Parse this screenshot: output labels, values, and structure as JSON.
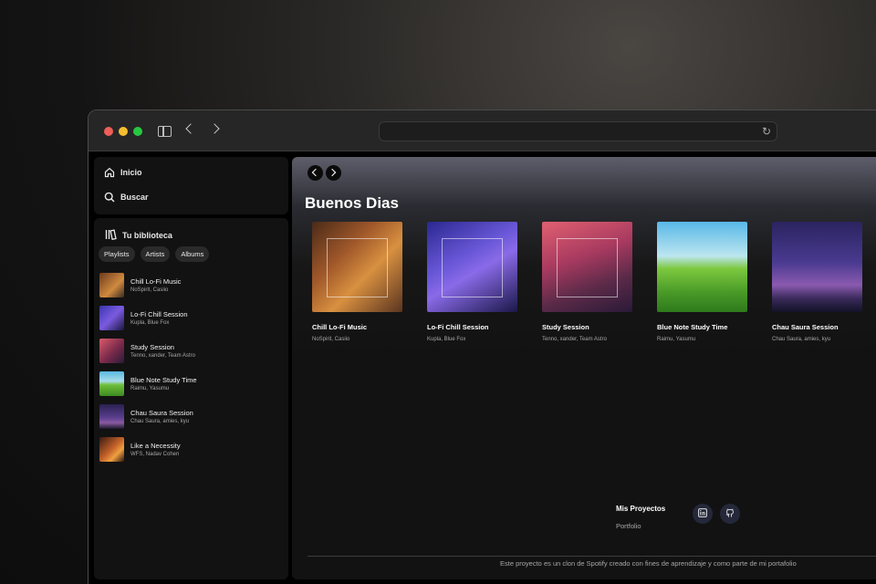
{
  "sidebar": {
    "nav": [
      {
        "label": "Inicio",
        "icon": "home-icon"
      },
      {
        "label": "Buscar",
        "icon": "search-icon"
      }
    ],
    "library": {
      "title": "Tu biblioteca",
      "icon": "library-icon",
      "filters": [
        "Playlists",
        "Artists",
        "Albums"
      ],
      "items": [
        {
          "title": "Chill Lo-Fi Music",
          "subtitle": "NoSpirit, Casiio",
          "color": "#b06a30"
        },
        {
          "title": "Lo-Fi Chill Session",
          "subtitle": "Kupla, Blue Fox",
          "color": "#5b4bc4"
        },
        {
          "title": "Study Session",
          "subtitle": "Tenno, xander, Team Astro",
          "color": "#b5445e"
        },
        {
          "title": "Blue Note Study Time",
          "subtitle": "Raimu, Yasumu",
          "color": "#72b84a"
        },
        {
          "title": "Chau Saura Session",
          "subtitle": "Chau Saura, amies, kyu",
          "color": "#5a3f8f"
        },
        {
          "title": "Like a Necessity",
          "subtitle": "WFS, Nadav Cohen",
          "color": "#c4622a"
        }
      ]
    }
  },
  "main": {
    "heading": "Buenos Dias",
    "cards": [
      {
        "title": "Chill Lo-Fi Music",
        "subtitle": "NoSpirit, Casiio"
      },
      {
        "title": "Lo-Fi Chill Session",
        "subtitle": "Kupla, Blue Fox"
      },
      {
        "title": "Study Session",
        "subtitle": "Tenno, xander, Team Astro"
      },
      {
        "title": "Blue Note Study Time",
        "subtitle": "Raimu, Yasumu"
      },
      {
        "title": "Chau Saura Session",
        "subtitle": "Chau Saura, amies, kyu"
      }
    ],
    "footer": {
      "title": "Mis Proyectos",
      "link": "Portfolio",
      "social": [
        "linkedin-icon",
        "github-icon"
      ],
      "disclaimer": "Este proyecto es un clon de Spotify creado con fines de aprendizaje y como parte de mi portafolio"
    }
  },
  "colors": {
    "app_bg": "#000000",
    "panel_bg": "#121212",
    "chip_bg": "#2a2a2a",
    "text_secondary": "#a7a7a7"
  }
}
